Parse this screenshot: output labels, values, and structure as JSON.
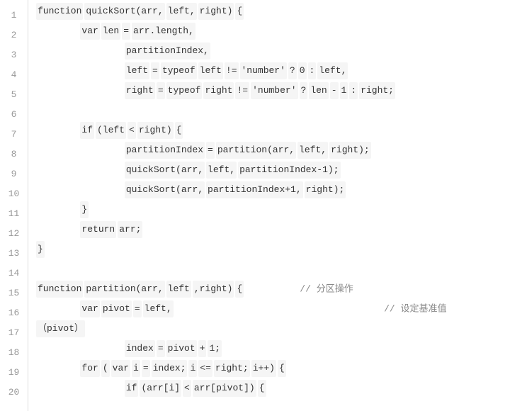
{
  "line_numbers": [
    "1",
    "2",
    "3",
    "4",
    "5",
    "6",
    "7",
    "8",
    "9",
    "10",
    "11",
    "12",
    "13",
    "14",
    "15",
    "16",
    "17",
    "18",
    "19",
    "20"
  ],
  "code_lines": [
    {
      "indent": 0,
      "tokens": [
        "function",
        "quickSort(arr,",
        "left,",
        "right)",
        "{"
      ],
      "trailing": ""
    },
    {
      "indent": 8,
      "tokens": [
        "var",
        "len",
        "=",
        "arr.length,"
      ],
      "trailing": ""
    },
    {
      "indent": 16,
      "tokens": [
        "partitionIndex,"
      ],
      "trailing": ""
    },
    {
      "indent": 16,
      "tokens": [
        "left",
        "=",
        "typeof",
        "left",
        "!=",
        "'number'",
        "?",
        "0",
        ":",
        "left,"
      ],
      "trailing": ""
    },
    {
      "indent": 16,
      "tokens": [
        "right",
        "=",
        "typeof",
        "right",
        "!=",
        "'number'",
        "?",
        "len",
        "-",
        "1",
        ":",
        "right;"
      ],
      "trailing": ""
    },
    {
      "indent": 0,
      "tokens": [],
      "trailing": ""
    },
    {
      "indent": 8,
      "tokens": [
        "if",
        "(left",
        "<",
        "right)",
        "{"
      ],
      "trailing": ""
    },
    {
      "indent": 16,
      "tokens": [
        "partitionIndex",
        "=",
        "partition(arr,",
        "left,",
        "right);"
      ],
      "trailing": ""
    },
    {
      "indent": 16,
      "tokens": [
        "quickSort(arr,",
        "left,",
        "partitionIndex-1);"
      ],
      "trailing": ""
    },
    {
      "indent": 16,
      "tokens": [
        "quickSort(arr,",
        "partitionIndex+1,",
        "right);"
      ],
      "trailing": ""
    },
    {
      "indent": 8,
      "tokens": [
        "}"
      ],
      "trailing": ""
    },
    {
      "indent": 8,
      "tokens": [
        "return",
        "arr;"
      ],
      "trailing": ""
    },
    {
      "indent": 0,
      "tokens": [
        "}"
      ],
      "trailing": ""
    },
    {
      "indent": 0,
      "tokens": [],
      "trailing": ""
    },
    {
      "indent": 0,
      "tokens": [
        "function",
        "partition(arr,",
        "left",
        ",right)",
        "{"
      ],
      "trailing": "          // 分区操作"
    },
    {
      "indent": 8,
      "tokens": [
        "var",
        "pivot",
        "=",
        "left,"
      ],
      "trailing": "                                      // 设定基准值（pivot）"
    },
    {
      "indent": 16,
      "tokens": [
        "index",
        "=",
        "pivot",
        "+",
        "1;"
      ],
      "trailing": ""
    },
    {
      "indent": 8,
      "tokens": [
        "for",
        "(",
        "var",
        "i",
        "=",
        "index;",
        "i",
        "<=",
        "right;",
        "i++)",
        "{"
      ],
      "trailing": ""
    },
    {
      "indent": 16,
      "tokens": [
        "if",
        "(arr[i]",
        "<",
        "arr[pivot])",
        "{"
      ],
      "trailing": ""
    },
    {
      "indent": 24,
      "tokens": [],
      "trailing": ""
    }
  ],
  "pivot_wrap_line": {
    "prefix": "（pivot）"
  }
}
